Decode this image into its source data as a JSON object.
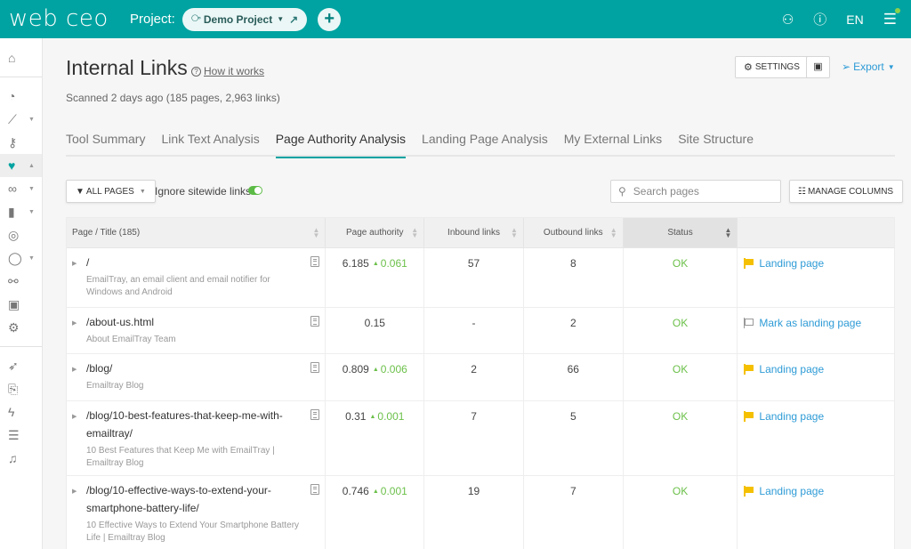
{
  "app": {
    "logo_main": "web ceo",
    "project_label": "Project:",
    "project_name": "Demo Project",
    "language": "EN",
    "brand_color": "#00a3a1"
  },
  "icons": {
    "project": "share-nodes-icon",
    "external": "external-link-icon",
    "add": "plus-icon",
    "users": "users-icon",
    "help": "question-circle-icon",
    "menu": "hamburger-menu-icon"
  },
  "sidebar": {
    "items": [
      {
        "name": "home",
        "glyph": "⌂",
        "caret": false,
        "active": false
      },
      {
        "name": "dashboard",
        "glyph": "◔",
        "caret": false,
        "active": false
      },
      {
        "name": "rankings",
        "glyph": "⟋",
        "caret": true,
        "active": false
      },
      {
        "name": "keywords",
        "glyph": "⚷",
        "caret": false,
        "active": false
      },
      {
        "name": "site-health",
        "glyph": "♥",
        "caret": true,
        "active": true
      },
      {
        "name": "links",
        "glyph": "∞",
        "caret": true,
        "active": false
      },
      {
        "name": "analytics",
        "glyph": "▮",
        "caret": true,
        "active": false
      },
      {
        "name": "local",
        "glyph": "◎",
        "caret": false,
        "active": false
      },
      {
        "name": "social",
        "glyph": "◯",
        "caret": true,
        "active": false
      },
      {
        "name": "competitors",
        "glyph": "⚯",
        "caret": false,
        "active": false
      },
      {
        "name": "calendar",
        "glyph": "▣",
        "caret": false,
        "active": false
      },
      {
        "name": "settings",
        "glyph": "⚙",
        "caret": false,
        "active": false
      }
    ],
    "items_bottom": [
      {
        "name": "rocket",
        "glyph": "➶"
      },
      {
        "name": "pdf-report",
        "glyph": "⎘"
      },
      {
        "name": "lightning",
        "glyph": "ϟ"
      },
      {
        "name": "task-list",
        "glyph": "☰"
      },
      {
        "name": "notifications",
        "glyph": "♫"
      }
    ]
  },
  "header": {
    "title": "Internal Links",
    "how_it_works": "How it works",
    "scanned": "Scanned 2 days ago  (185 pages, 2,963 links)",
    "settings_label": "SETTINGS",
    "export_label": "Export"
  },
  "tabs": [
    {
      "label": "Tool Summary",
      "active": false
    },
    {
      "label": "Link Text Analysis",
      "active": false
    },
    {
      "label": "Page Authority Analysis",
      "active": true
    },
    {
      "label": "Landing Page Analysis",
      "active": false
    },
    {
      "label": "My External Links",
      "active": false
    },
    {
      "label": "Site Structure",
      "active": false
    }
  ],
  "toolbar": {
    "filter_label": "ALL PAGES",
    "ignore_sitewide_label": "Ignore sitewide links",
    "ignore_sitewide_on": true,
    "search_placeholder": "Search pages",
    "search_value": "",
    "manage_columns_label": "MANAGE COLUMNS"
  },
  "table": {
    "columns": [
      "Page / Title (185)",
      "Page authority",
      "Inbound links",
      "Outbound links",
      "Status",
      ""
    ],
    "sorted_column": "Status",
    "rows": [
      {
        "url": "/",
        "title": "EmailTray, an email client and email notifier for Windows and Android",
        "pa": "6.185",
        "pa_delta": "0.061",
        "inbound": "57",
        "outbound": "8",
        "status": "OK",
        "landing": "Landing page",
        "is_landing": true
      },
      {
        "url": "/about-us.html",
        "title": "About EmailTray Team",
        "pa": "0.15",
        "pa_delta": "",
        "inbound": "-",
        "outbound": "2",
        "status": "OK",
        "landing": "Mark as landing page",
        "is_landing": false
      },
      {
        "url": "/blog/",
        "title": "Emailtray Blog",
        "pa": "0.809",
        "pa_delta": "0.006",
        "inbound": "2",
        "outbound": "66",
        "status": "OK",
        "landing": "Landing page",
        "is_landing": true
      },
      {
        "url": "/blog/10-best-features-that-keep-me-with-emailtray/",
        "title": "10 Best Features that Keep Me with EmailTray | Emailtray Blog",
        "pa": "0.31",
        "pa_delta": "0.001",
        "inbound": "7",
        "outbound": "5",
        "status": "OK",
        "landing": "Landing page",
        "is_landing": true
      },
      {
        "url": "/blog/10-effective-ways-to-extend-your-smartphone-battery-life/",
        "title": "10 Effective Ways to Extend Your Smartphone Battery Life | Emailtray Blog",
        "pa": "0.746",
        "pa_delta": "0.001",
        "inbound": "19",
        "outbound": "7",
        "status": "OK",
        "landing": "Landing page",
        "is_landing": true
      }
    ]
  }
}
